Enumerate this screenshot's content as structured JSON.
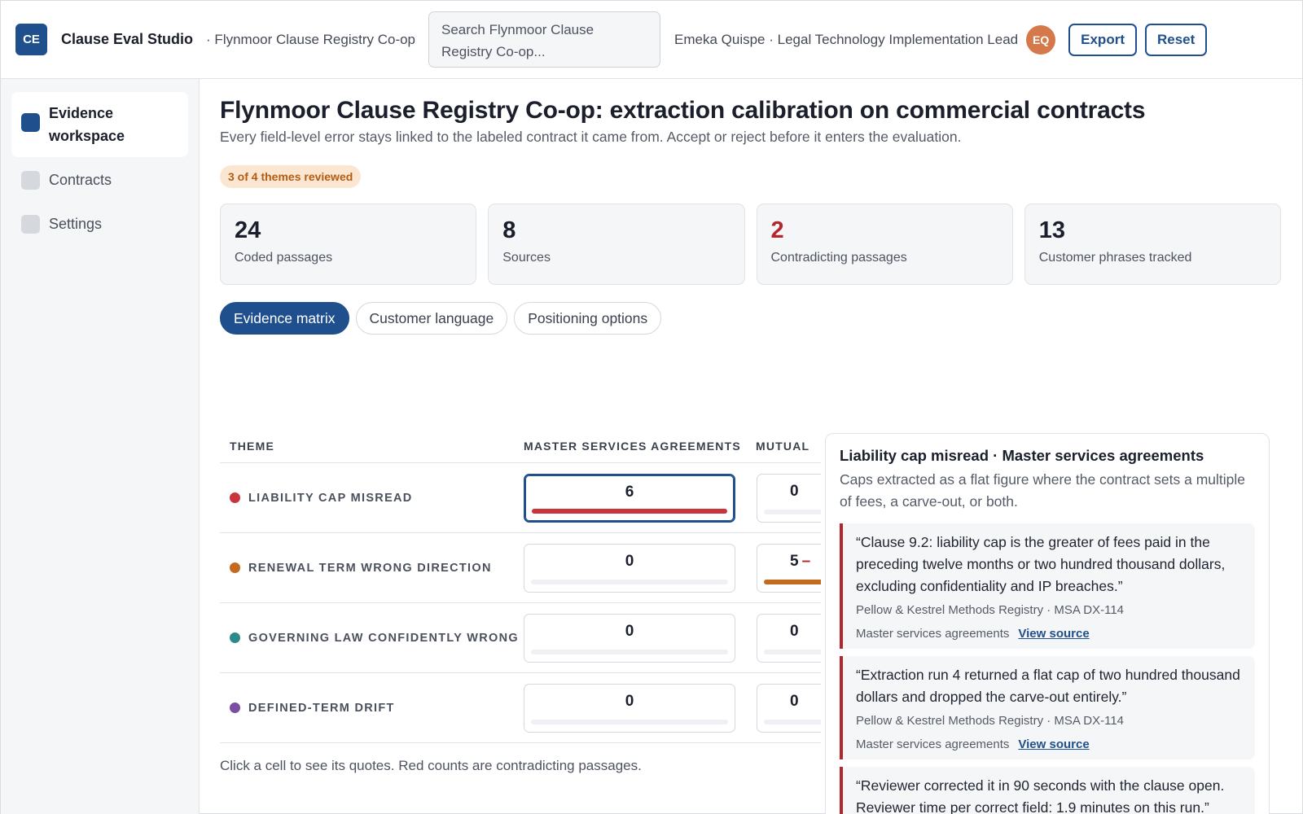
{
  "app": {
    "logo_initials": "CE",
    "title": "Clause Eval Studio",
    "org_crumb": "· Flynmoor Clause Registry Co-op"
  },
  "search": {
    "placeholder": "Search Flynmoor Clause Registry Co-op..."
  },
  "user": {
    "label": "Emeka Quispe · Legal Technology Implementation Lead",
    "initials": "EQ",
    "avatar_color": "#d5784a"
  },
  "actions": {
    "export_label": "Export",
    "reset_label": "Reset"
  },
  "sidebar": {
    "items": [
      {
        "label": "Evidence workspace",
        "active": true
      },
      {
        "label": "Contracts",
        "active": false
      },
      {
        "label": "Settings",
        "active": false
      }
    ]
  },
  "page": {
    "title": "Flynmoor Clause Registry Co-op: extraction calibration on commercial contracts",
    "subtitle": "Every field-level error stays linked to the labeled contract it came from. Accept or reject before it enters the evaluation.",
    "progress_badge": "3 of 4 themes reviewed"
  },
  "stats": [
    {
      "value": "24",
      "label": "Coded passages"
    },
    {
      "value": "8",
      "label": "Sources"
    },
    {
      "value": "2",
      "label": "Contradicting passages",
      "alert": true
    },
    {
      "value": "13",
      "label": "Customer phrases tracked"
    }
  ],
  "tabs": [
    {
      "label": "Evidence matrix",
      "active": true
    },
    {
      "label": "Customer language",
      "active": false
    },
    {
      "label": "Positioning options",
      "active": false
    }
  ],
  "matrix": {
    "headers": {
      "theme": "THEME",
      "col1": "MASTER SERVICES AGREEMENTS",
      "col2": "MUTUAL"
    },
    "rows": [
      {
        "theme": "LIABILITY CAP MISREAD",
        "dot_color": "#c9353a",
        "col1": "6",
        "col1_fill": 1.0,
        "col1_bar": "#c9353a",
        "col2": "0",
        "col2_fill": 0
      },
      {
        "theme": "RENEWAL TERM WRONG DIRECTION",
        "dot_color": "#c46a1f",
        "col1": "0",
        "col1_fill": 0,
        "col2": "5",
        "col2_fill": 0.83,
        "col2_bar": "#c46a1f",
        "col2_dash": "–"
      },
      {
        "theme": "GOVERNING LAW CONFIDENTLY WRONG",
        "dot_color": "#2b8a8a",
        "col1": "0",
        "col1_fill": 0,
        "col2": "0",
        "col2_fill": 0
      },
      {
        "theme": "DEFINED-TERM DRIFT",
        "dot_color": "#7a4ea3",
        "col1": "0",
        "col1_fill": 0,
        "col2": "0",
        "col2_fill": 0
      }
    ],
    "footnote": "Click a cell to see its quotes. Red counts are contradicting passages."
  },
  "detail": {
    "title": "Liability cap misread · Master services agreements",
    "description": "Caps extracted as a flat figure where the contract sets a multiple of fees, a carve-out, or both.",
    "quotes": [
      {
        "text": "“Clause 9.2: liability cap is the greater of fees paid in the preceding twelve months or two hundred thousand dollars, excluding confidentiality and IP breaches.”",
        "source": "Pellow & Kestrel Methods Registry · MSA DX-114",
        "category": "Master services agreements",
        "link": "View source"
      },
      {
        "text": "“Extraction run 4 returned a flat cap of two hundred thousand dollars and dropped the carve-out entirely.”",
        "source": "Pellow & Kestrel Methods Registry · MSA DX-114",
        "category": "Master services agreements",
        "link": "View source"
      },
      {
        "text": "“Reviewer corrected it in 90 seconds with the clause open. Reviewer time per correct field: 1.9 minutes on this run.”"
      }
    ]
  }
}
